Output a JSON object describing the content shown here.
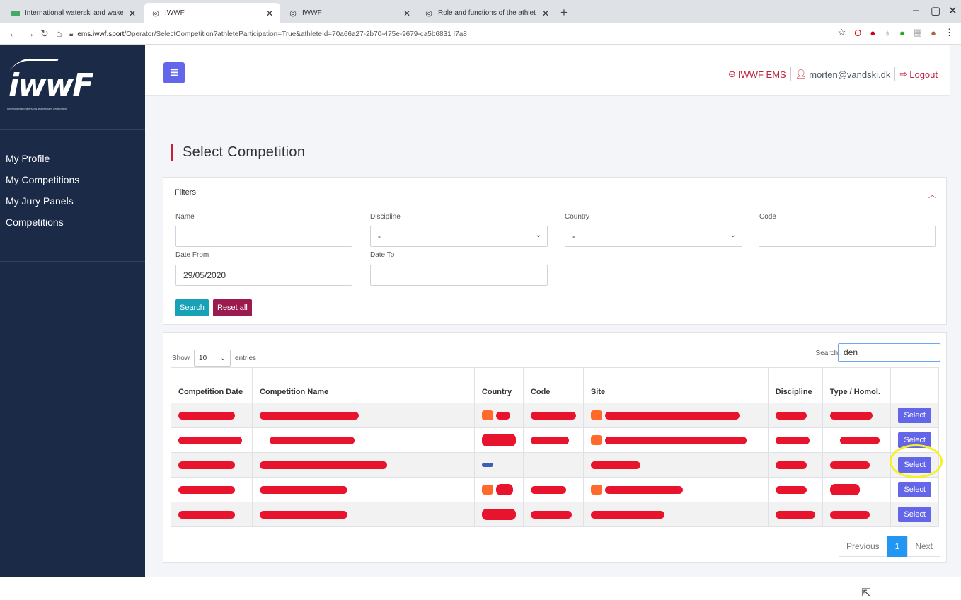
{
  "browser": {
    "tabs": [
      {
        "label": "International waterski and wakeb",
        "icon": "flag-icon"
      },
      {
        "label": "IWWF",
        "icon": "globe-icon"
      },
      {
        "label": "IWWF",
        "icon": "globe-icon"
      },
      {
        "label": "Role and functions of the athlete",
        "icon": "globe-icon"
      }
    ],
    "url_host": "ems.iwwf.sport",
    "url_path": "/Operator/SelectCompetition?athleteParticipation=True&athleteId=70a66a27-2b70-475e-9679-ca5b6831 I7a8"
  },
  "sidebar": {
    "logo_text": "iwwF",
    "logo_sub": "International Waterski & Wakeboard Federation",
    "items": [
      {
        "label": "My Profile"
      },
      {
        "label": "My Competitions"
      },
      {
        "label": "My Jury Panels"
      },
      {
        "label": "Competitions"
      }
    ]
  },
  "header": {
    "ems_label": "IWWF EMS",
    "email": "morten@vandski.dk",
    "logout_label": "Logout"
  },
  "page": {
    "title": "Select Competition"
  },
  "filters": {
    "title": "Filters",
    "name_label": "Name",
    "name_value": "",
    "discipline_label": "Discipline",
    "discipline_value": "-",
    "country_label": "Country",
    "country_value": "-",
    "code_label": "Code",
    "code_value": "",
    "date_from_label": "Date From",
    "date_from_value": "29/05/2020",
    "date_to_label": "Date To",
    "date_to_value": "",
    "search_label": "Search",
    "reset_label": "Reset all"
  },
  "table": {
    "show_label": "Show",
    "entries_value": "10",
    "entries_label": "entries",
    "search_label": "Search:",
    "search_value": "den",
    "columns": [
      "Competition Date",
      "Competition Name",
      "Country",
      "Code",
      "Site",
      "Discipline",
      "Type / Homol.",
      ""
    ],
    "select_label": "Select",
    "rows": [
      {},
      {},
      {},
      {},
      {}
    ]
  },
  "pagination": {
    "previous": "Previous",
    "page": "1",
    "next": "Next"
  }
}
